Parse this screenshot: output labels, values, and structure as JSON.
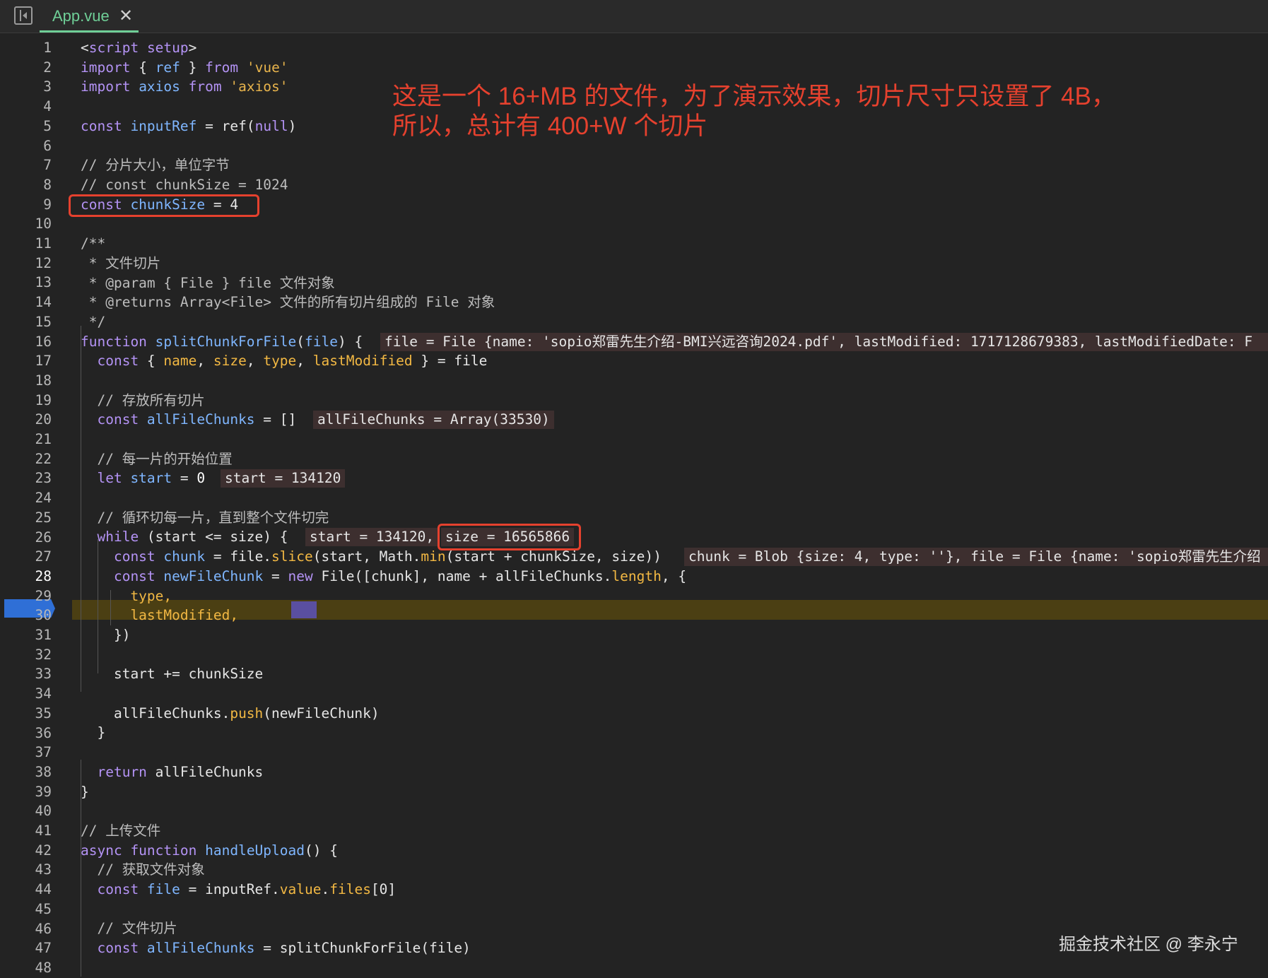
{
  "tab": {
    "label": "App.vue",
    "close_glyph": "✕"
  },
  "icons": {
    "panel": "sidebar-toggle-icon",
    "close": "close-icon"
  },
  "editor": {
    "current_line": "28",
    "line_numbers": [
      "1",
      "2",
      "3",
      "4",
      "5",
      "6",
      "7",
      "8",
      "9",
      "10",
      "11",
      "12",
      "13",
      "14",
      "15",
      "16",
      "17",
      "18",
      "19",
      "20",
      "21",
      "22",
      "23",
      "24",
      "25",
      "26",
      "27",
      "28",
      "29",
      "30",
      "31",
      "32",
      "33",
      "34",
      "35",
      "36",
      "37",
      "38",
      "39",
      "40",
      "41",
      "42",
      "43",
      "44",
      "45",
      "46",
      "47",
      "48"
    ],
    "code": {
      "l1a": "<",
      "l1b": "script ",
      "l1c": "setup",
      "l1d": ">",
      "l2a": "import",
      "l2b": " { ",
      "l2c": "ref",
      "l2d": " } ",
      "l2e": "from",
      "l2f": " 'vue'",
      "l3a": "import",
      "l3b": " axios ",
      "l3c": "from",
      "l3d": " 'axios'",
      "l5a": "const",
      "l5b": " inputRef",
      "l5c": " = ",
      "l5d": "ref",
      "l5e": "(",
      "l5f": "null",
      "l5g": ")",
      "l7": "// 分片大小，单位字节",
      "l8": "// const chunkSize = 1024",
      "l9a": "const",
      "l9b": " chunkSize",
      "l9c": " = 4",
      "l11": "/**",
      "l12": " * 文件切片",
      "l13": " * @param { File } file 文件对象",
      "l14": " * @returns Array<File> 文件的所有切片组成的 File 对象",
      "l15": " */",
      "l16a": "function",
      "l16b": " splitChunkForFile",
      "l16c": "(",
      "l16d": "file",
      "l16e": ") {",
      "l17a": "  const",
      "l17b": " { ",
      "l17c": "name",
      "l17d": ", ",
      "l17e": "size",
      "l17f": ", ",
      "l17g": "type",
      "l17h": ", ",
      "l17i": "lastModified",
      "l17j": " } = file",
      "l19": "  // 存放所有切片",
      "l20a": "  const",
      "l20b": " allFileChunks",
      "l20c": " = []",
      "l22": "  // 每一片的开始位置",
      "l23a": "  let",
      "l23b": " start",
      "l23c": " = ",
      "l23d": "0",
      "l25": "  // 循环切每一片，直到整个文件切完",
      "l26a": "  while",
      "l26b": " (start <= size) {",
      "l27a": "    const",
      "l27b": " chunk",
      "l27c": " = file.",
      "l27d": "slice",
      "l27e": "(start, Math.",
      "l27f": "min",
      "l27g": "(start + chunkSize, size))",
      "l28a": "    const",
      "l28b": " newFileChunk",
      "l28c": " = ",
      "l28d": "new",
      "l28e": " File([chunk], name + allFileChunks.",
      "l28f": "length",
      "l28g": ", {",
      "l29": "      type,",
      "l30": "      lastModified,",
      "l31": "    })",
      "l33": "    start += chunkSize",
      "l35a": "    allFileChunks.",
      "l35b": "push",
      "l35c": "(newFileChunk)",
      "l36": "  }",
      "l38a": "  return",
      "l38b": " allFileChunks",
      "l39": "}",
      "l41": "// 上传文件",
      "l42a": "async",
      "l42b": " function",
      "l42c": " handleUpload",
      "l42d": "() {",
      "l43": "  // 获取文件对象",
      "l44a": "  const",
      "l44b": " file",
      "l44c": " = inputRef.",
      "l44d": "value",
      "l44e": ".",
      "l44f": "files",
      "l44g": "[0]",
      "l46": "  // 文件切片",
      "l47a": "  const",
      "l47b": " allFileChunks",
      "l47c": " = splitChunkForFile(file)"
    },
    "inline_values": {
      "l16": "file = File {name: 'sopio郑雷先生介绍-BMI兴远咨询2024.pdf', lastModified: 1717128679383, lastModifiedDate: F",
      "l20": "allFileChunks = Array(33530)",
      "l23": "start = 134120",
      "l26a": "start = 134120,",
      "l26b": "size = 16565866",
      "l27": "chunk = Blob {size: 4, type: ''}, file = File {name: 'sopio郑雷先生介绍"
    }
  },
  "annotation": {
    "line1": "这是一个 16+MB  的文件，为了演示效果，切片尺寸只设置了 4B，",
    "line2": "所以，总计有 400+W 个切片"
  },
  "watermark": "掘金技术社区 @ 李永宁",
  "colors": {
    "keyword": "#b493f5",
    "function": "#7fb6ff",
    "string": "#e8b44c",
    "property": "#f2b843",
    "annotation": "#e5412e",
    "exec_line": "#4b3f13",
    "tab_active": "#6fcf97",
    "breakpoint": "#2f6fd6"
  }
}
